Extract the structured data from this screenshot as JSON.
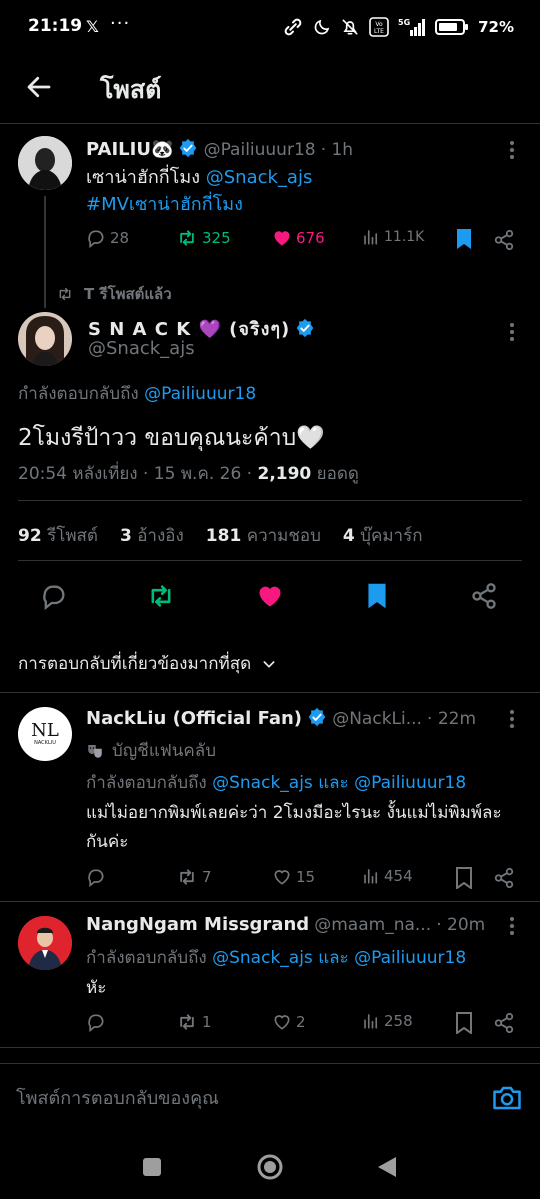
{
  "status_bar": {
    "time": "21:19",
    "x_logo": "𝕏",
    "more": "···",
    "battery": "72%"
  },
  "header": {
    "title": "โพสต์"
  },
  "parent_tweet": {
    "name": "PAILIU🐼",
    "handle": "@Pailiuuur18",
    "time": "· 1h",
    "text": "เซาน่าฮักกี่โมง",
    "mention": "@Snack_ajs",
    "hashtag": "#MVเซาน่าฮักกี่โมง",
    "replies": "28",
    "retweets": "325",
    "likes": "676",
    "views": "11.1K"
  },
  "retweet_label": "T รีโพสต์แล้ว",
  "main_tweet": {
    "name": "S N A C K 💜 (จริงๆ)",
    "handle": "@Snack_ajs",
    "reply_prefix": "กำลังตอบกลับถึง",
    "reply_to": "@Pailiuuur18",
    "text": "2โมงรีป้าวว  ขอบคุณนะค้าบ🤍",
    "meta": "20:54 หลังเที่ยง · 15 พ.ค. 26 · ",
    "views_count": "2,190",
    "views_label": " ยอดดู",
    "stats": {
      "retweets_count": "92",
      "retweets_label": "รีโพสต์",
      "quotes_count": "3",
      "quotes_label": "อ้างอิง",
      "likes_count": "181",
      "likes_label": "ความชอบ",
      "bookmarks_count": "4",
      "bookmarks_label": "บุ๊คมาร์ก"
    }
  },
  "sort_label": "การตอบกลับที่เกี่ยวข้องมากที่สุด",
  "replies": [
    {
      "name": "NackLiu (Official Fan)",
      "handle": "@NackLi...",
      "time": "· 22m",
      "badge": "บัญชีแฟนคลับ",
      "reply_prefix": "กำลังตอบกลับถึง",
      "reply_to_1": "@Snack_ajs",
      "reply_and": "และ",
      "reply_to_2": "@Pailiuuur18",
      "text": "แม่ไม่อยากพิมพ์เลยค่ะว่า 2โมงมีอะไรนะ งั้นแม่ไม่พิมพ์ละกันค่ะ",
      "avatar_text": "NL",
      "avatar_sub": "NACKLIU",
      "replies": "",
      "retweets": "7",
      "likes": "15",
      "views": "454"
    },
    {
      "name": "NangNgam Missgrand",
      "handle": "@maam_na...",
      "time": "· 20m",
      "reply_prefix": "กำลังตอบกลับถึง",
      "reply_to_1": "@Snack_ajs",
      "reply_and": "และ",
      "reply_to_2": "@Pailiuuur18",
      "text": "หัะ",
      "replies": "",
      "retweets": "1",
      "likes": "2",
      "views": "258"
    }
  ],
  "reply_bar": {
    "placeholder": "โพสต์การตอบกลับของคุณ"
  },
  "colors": {
    "accent": "#1d9bf0",
    "retweet": "#00ba7c",
    "like": "#f91880",
    "muted": "#71767b",
    "background": "#000000"
  }
}
